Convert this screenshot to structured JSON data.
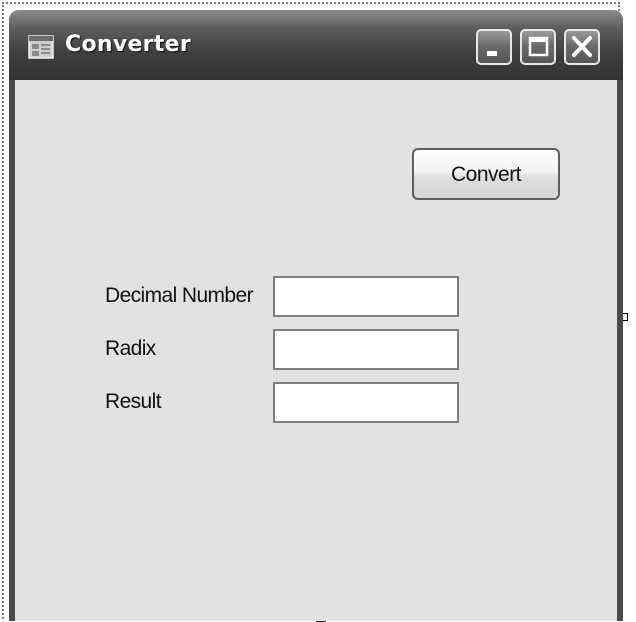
{
  "window": {
    "title": "Converter",
    "icon": "form-icon",
    "controls": {
      "minimize": "minimize-icon",
      "maximize": "maximize-icon",
      "close": "close-icon"
    }
  },
  "form": {
    "convert_button_label": "Convert",
    "fields": [
      {
        "label": "Decimal Number",
        "value": ""
      },
      {
        "label": "Radix",
        "value": ""
      },
      {
        "label": "Result",
        "value": ""
      }
    ]
  },
  "colors": {
    "titlebar": "#3f3f3f",
    "client_background": "#e2e2e2",
    "field_background": "#ffffff"
  }
}
